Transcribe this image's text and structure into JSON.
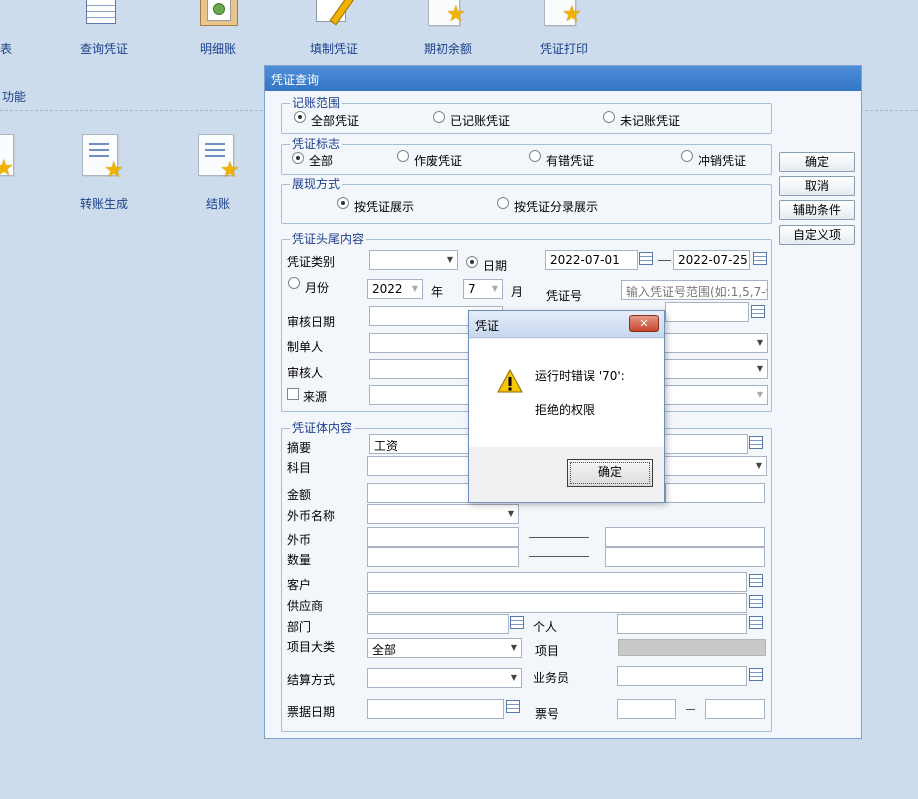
{
  "toolbar": {
    "items": [
      {
        "label": "表",
        "icon": "report-icon"
      },
      {
        "label": "查询凭证",
        "icon": "voucher-query-icon"
      },
      {
        "label": "明细账",
        "icon": "ledger-detail-icon"
      },
      {
        "label": "填制凭证",
        "icon": "voucher-edit-icon"
      },
      {
        "label": "期初余额",
        "icon": "opening-balance-icon"
      },
      {
        "label": "凭证打印",
        "icon": "voucher-print-icon"
      }
    ],
    "section_label": "功能",
    "functions": [
      {
        "label": "转账生成"
      },
      {
        "label": "结账"
      }
    ]
  },
  "query_dialog": {
    "title": "凭证查询",
    "range": {
      "legend": "记账范围",
      "options": [
        "全部凭证",
        "已记账凭证",
        "未记账凭证"
      ],
      "selected": "全部凭证"
    },
    "flag": {
      "legend": "凭证标志",
      "options": [
        "全部",
        "作废凭证",
        "有错凭证",
        "冲销凭证"
      ],
      "selected": "全部"
    },
    "display": {
      "legend": "展现方式",
      "options": [
        "按凭证展示",
        "按凭证分录展示"
      ],
      "selected": "按凭证展示"
    },
    "head": {
      "legend": "凭证头尾内容",
      "voucher_type_label": "凭证类别",
      "date_label": "日期",
      "date_from": "2022-07-01",
      "date_to": "2022-07-25",
      "month_label": "月份",
      "year_value": "2022",
      "year_unit": "年",
      "month_value": "7",
      "month_unit": "月",
      "voucher_no_label": "凭证号",
      "voucher_no_placeholder": "输入凭证号范围(如:1,5,7-9)",
      "audit_date_label": "审核日期",
      "maker_label": "制单人",
      "auditor_label": "审核人",
      "source_label": "来源"
    },
    "body": {
      "legend": "凭证体内容",
      "summary_label": "摘要",
      "summary_value": "工资",
      "subject_label": "科目",
      "amount_label": "金额",
      "currency_name_label": "外币名称",
      "foreign_label": "外币",
      "quantity_label": "数量",
      "customer_label": "客户",
      "supplier_label": "供应商",
      "department_label": "部门",
      "person_label": "个人",
      "project_class_label": "项目大类",
      "project_class_value": "全部",
      "project_label": "项目",
      "settlement_label": "结算方式",
      "salesman_label": "业务员",
      "bill_date_label": "票据日期",
      "bill_no_label": "票号"
    },
    "buttons": {
      "ok": "确定",
      "cancel": "取消",
      "aux": "辅助条件",
      "custom": "自定义项"
    }
  },
  "error_dialog": {
    "title": "凭证",
    "close": "✕",
    "message_line1": "运行时错误 '70':",
    "message_line2": "拒绝的权限",
    "ok": "确定"
  },
  "colors": {
    "title_bar": "#3f82d0",
    "background": "#cddcec",
    "legend_text": "#1d3f8c"
  }
}
